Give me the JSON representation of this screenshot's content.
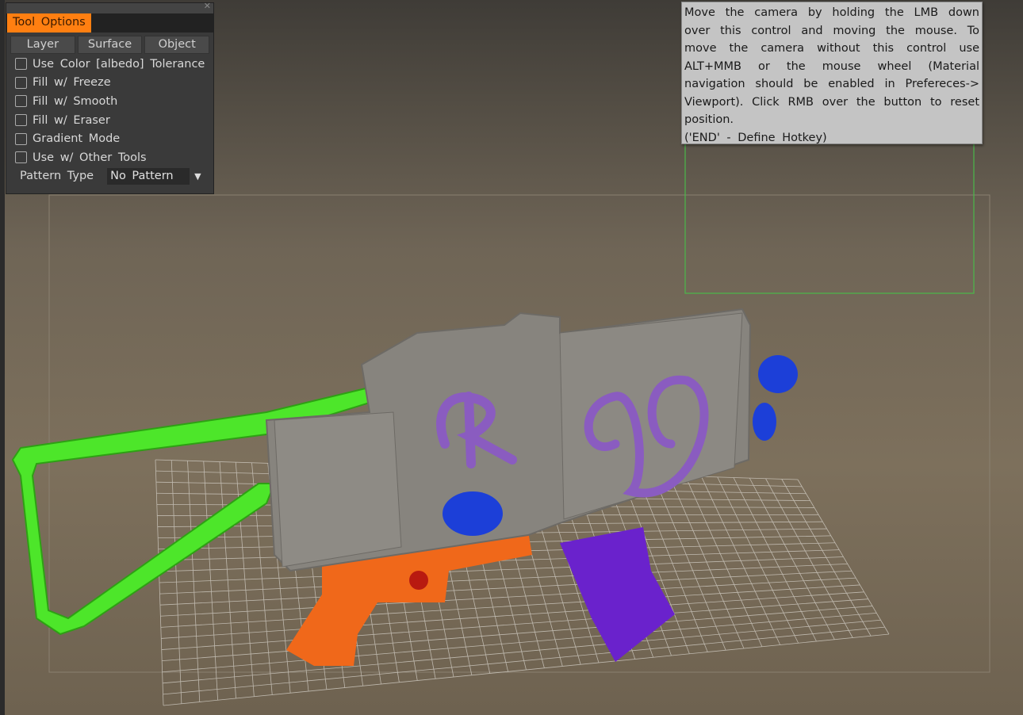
{
  "tool_options": {
    "tab_label": "Tool Options",
    "close_icon": "close-icon",
    "buttons": [
      "Layer",
      "Surface",
      "Object"
    ],
    "checkboxes": [
      {
        "label": "Use Color [albedo] Tolerance",
        "checked": false
      },
      {
        "label": "Fill w/ Freeze",
        "checked": false
      },
      {
        "label": "Fill w/ Smooth",
        "checked": false
      },
      {
        "label": "Fill w/ Eraser",
        "checked": false
      },
      {
        "label": "Gradient Mode",
        "checked": false
      },
      {
        "label": "Use w/ Other Tools",
        "checked": false
      }
    ],
    "pattern_type_label": "Pattern Type",
    "pattern_type_value": "No Pattern",
    "accent_color": "#ff7f11"
  },
  "tooltip": {
    "text": "Move the camera by holding the LMB down over this control and moving the mouse. To move the camera without this control use ALT+MMB or the mouse wheel (Material navigation should be enabled in Prefereces-> Viewport). Click RMB over the button to reset position.",
    "hotkey": "('END' - Define Hotkey)"
  },
  "viewport": {
    "model_letters": "R"
  }
}
